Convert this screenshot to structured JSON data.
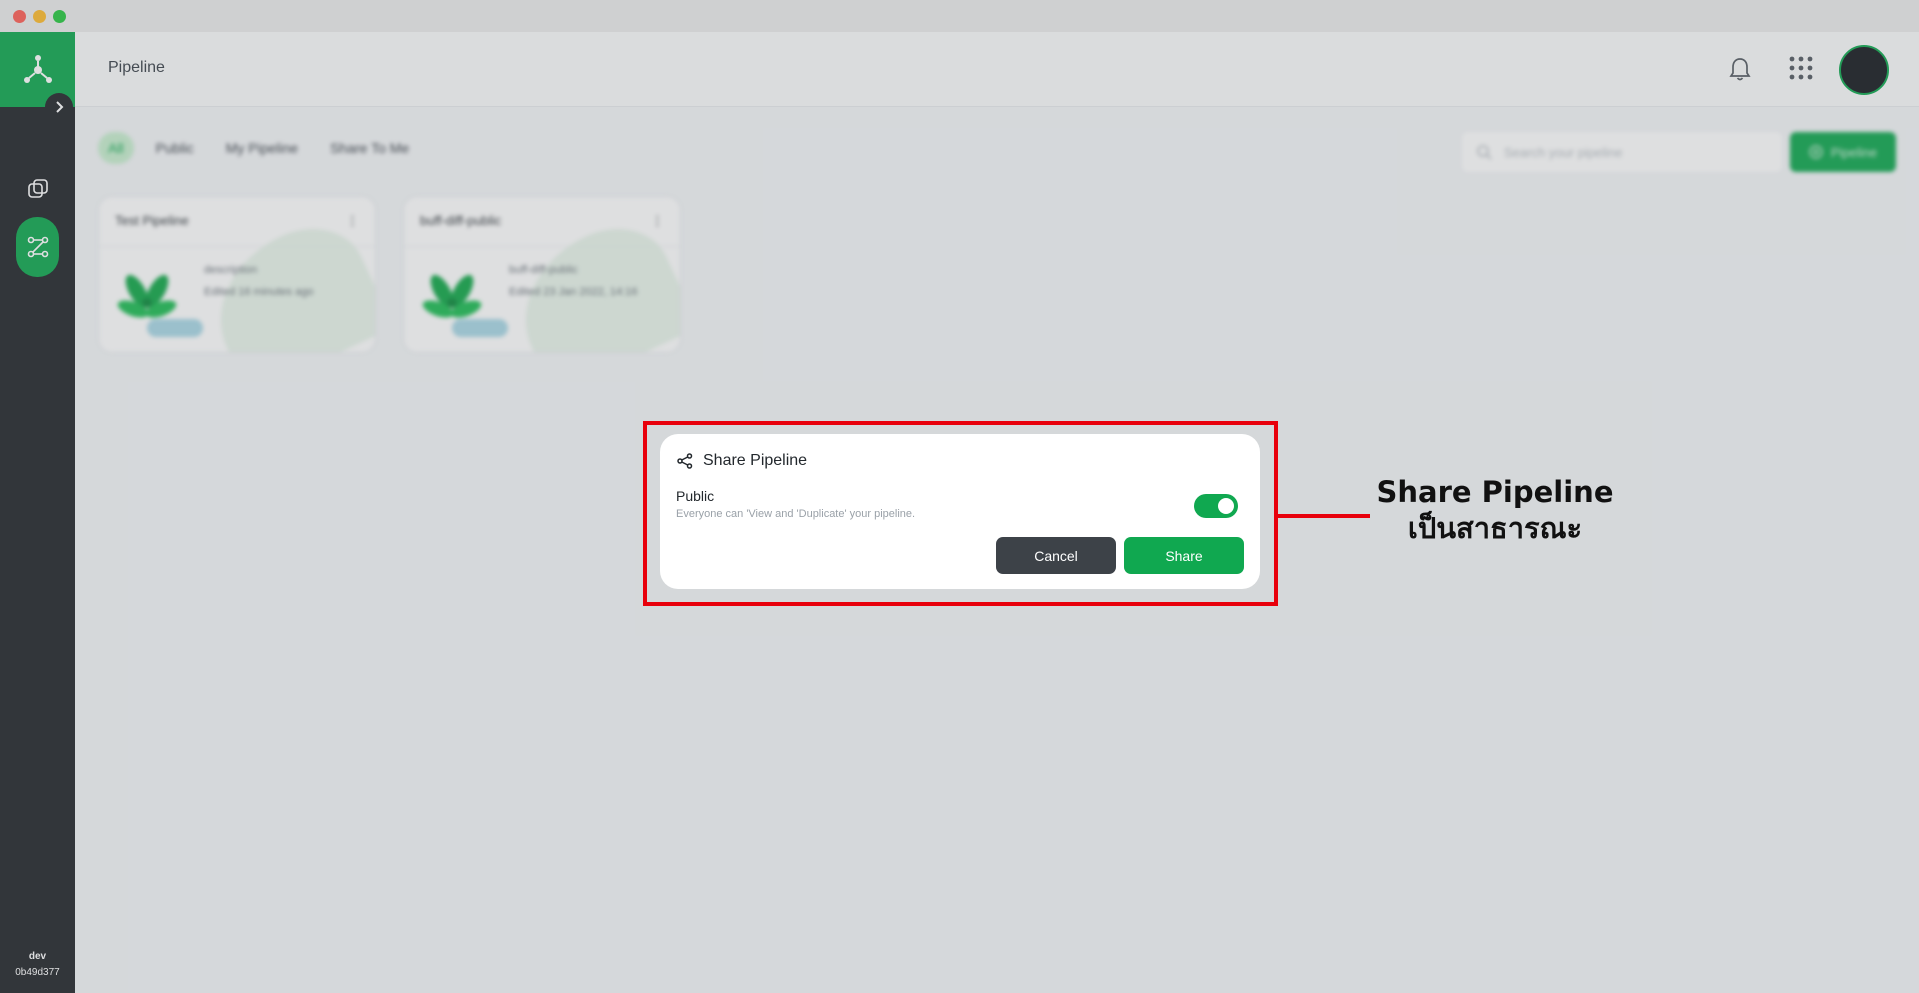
{
  "window": {
    "title_buttons": [
      "close",
      "minimize",
      "zoom"
    ]
  },
  "sidebar": {
    "logo_icon": "network-logo-icon",
    "collapse_icon": "chevron-right-icon",
    "items": [
      {
        "icon": "copy-icon",
        "active": false
      },
      {
        "icon": "pipeline-icon",
        "active": true
      }
    ],
    "footer": {
      "env": "dev",
      "version": "0b49d377"
    }
  },
  "header": {
    "title": "Pipeline",
    "bell_icon": "bell-icon",
    "apps_icon": "apps-grid-icon",
    "avatar": "user-avatar"
  },
  "filters": {
    "tabs": [
      {
        "label": "All",
        "active": true
      },
      {
        "label": "Public",
        "active": false
      },
      {
        "label": "My Pipeline",
        "active": false
      },
      {
        "label": "Share To Me",
        "active": false
      }
    ],
    "search_placeholder": "Search your pipeline",
    "new_button_label": "Pipeline"
  },
  "cards": [
    {
      "title": "Test Pipeline",
      "description": "description",
      "meta": "Edited 16 minutes ago"
    },
    {
      "title": "buff-diff-public",
      "description": "buff-diff-public",
      "meta": "Edited 23 Jan 2022, 14:16"
    }
  ],
  "dialog": {
    "title": "Share Pipeline",
    "title_icon": "share-icon",
    "option_label": "Public",
    "option_help": "Everyone can 'View and 'Duplicate' your pipeline.",
    "toggle_on": true,
    "cancel_label": "Cancel",
    "share_label": "Share"
  },
  "annotation": {
    "line1": "Share Pipeline",
    "line2": "เป็นสาธารณะ",
    "color": "#e8000b"
  },
  "colors": {
    "accent": "#10a850",
    "sidebar": "#23272b",
    "highlight": "#e8000b"
  }
}
